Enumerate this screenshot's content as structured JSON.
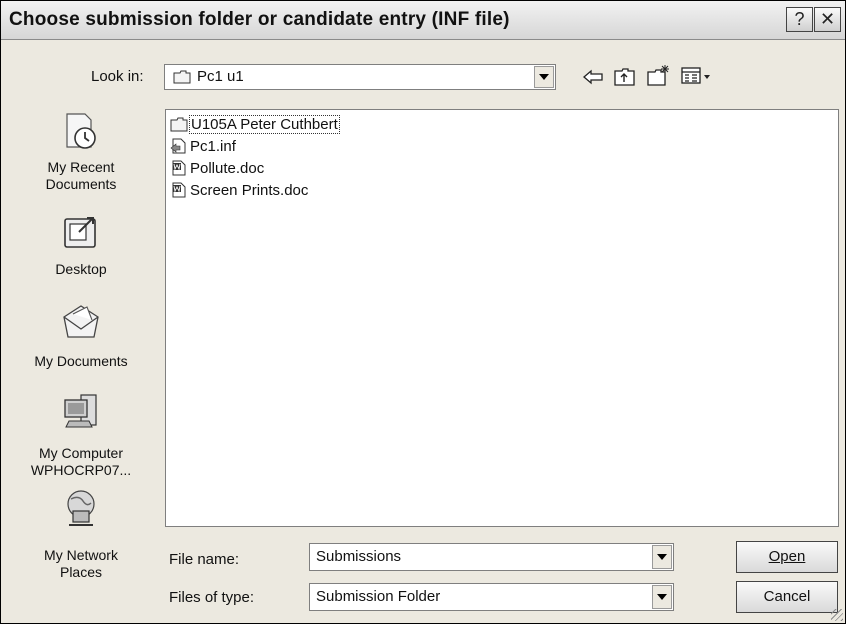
{
  "window": {
    "title": "Choose submission folder or candidate entry (INF file)",
    "help_glyph": "?",
    "close_glyph": "✕"
  },
  "toolbar": {
    "look_in_label": "Look in:",
    "look_in_value": "Pc1 u1"
  },
  "places": [
    {
      "label": "My Recent Documents",
      "icon": "recent-documents-icon"
    },
    {
      "label": "Desktop",
      "icon": "desktop-icon"
    },
    {
      "label": "My Documents",
      "icon": "my-documents-icon"
    },
    {
      "label": "My Computer WPHOCRP07...",
      "icon": "my-computer-icon"
    },
    {
      "label": "My Network Places",
      "icon": "network-places-icon"
    }
  ],
  "files": [
    {
      "name": "U105A Peter Cuthbert",
      "type": "folder",
      "selected": true
    },
    {
      "name": "Pc1.inf",
      "type": "inf"
    },
    {
      "name": "Pollute.doc",
      "type": "doc"
    },
    {
      "name": "Screen Prints.doc",
      "type": "doc"
    }
  ],
  "form": {
    "file_name_label": "File name:",
    "file_name_value": "Submissions",
    "files_of_type_label": "Files of type:",
    "files_of_type_value": "Submission Folder"
  },
  "buttons": {
    "open": "Open",
    "cancel": "Cancel"
  }
}
